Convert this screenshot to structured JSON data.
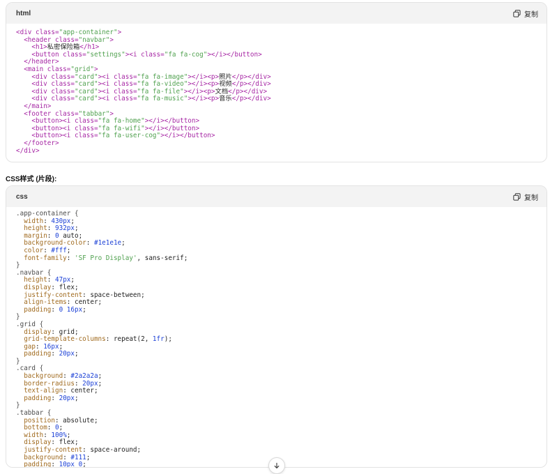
{
  "html_block": {
    "lang": "html",
    "copy_label": "复制",
    "lines": [
      [
        [
          "tag",
          "<div "
        ],
        [
          "attr",
          "class="
        ],
        [
          "str",
          "\"app-container\""
        ],
        [
          "tag",
          ">"
        ]
      ],
      [
        [
          "kw",
          "  "
        ],
        [
          "tag",
          "<header "
        ],
        [
          "attr",
          "class="
        ],
        [
          "str",
          "\"navbar\""
        ],
        [
          "tag",
          ">"
        ]
      ],
      [
        [
          "kw",
          "    "
        ],
        [
          "tag",
          "<h1>"
        ],
        [
          "kw",
          "私密保险箱"
        ],
        [
          "tag",
          "</h1>"
        ]
      ],
      [
        [
          "kw",
          "    "
        ],
        [
          "tag",
          "<button "
        ],
        [
          "attr",
          "class="
        ],
        [
          "str",
          "\"settings\""
        ],
        [
          "tag",
          "><i "
        ],
        [
          "attr",
          "class="
        ],
        [
          "str",
          "\"fa fa-cog\""
        ],
        [
          "tag",
          "></i></button>"
        ]
      ],
      [
        [
          "kw",
          "  "
        ],
        [
          "tag",
          "</header>"
        ]
      ],
      [
        [
          "kw",
          "  "
        ],
        [
          "tag",
          "<main "
        ],
        [
          "attr",
          "class="
        ],
        [
          "str",
          "\"grid\""
        ],
        [
          "tag",
          ">"
        ]
      ],
      [
        [
          "kw",
          "    "
        ],
        [
          "tag",
          "<div "
        ],
        [
          "attr",
          "class="
        ],
        [
          "str",
          "\"card\""
        ],
        [
          "tag",
          "><i "
        ],
        [
          "attr",
          "class="
        ],
        [
          "str",
          "\"fa fa-image\""
        ],
        [
          "tag",
          "></i><p>"
        ],
        [
          "kw",
          "照片"
        ],
        [
          "tag",
          "</p></div>"
        ]
      ],
      [
        [
          "kw",
          "    "
        ],
        [
          "tag",
          "<div "
        ],
        [
          "attr",
          "class="
        ],
        [
          "str",
          "\"card\""
        ],
        [
          "tag",
          "><i "
        ],
        [
          "attr",
          "class="
        ],
        [
          "str",
          "\"fa fa-video\""
        ],
        [
          "tag",
          "></i><p>"
        ],
        [
          "kw",
          "视频"
        ],
        [
          "tag",
          "</p></div>"
        ]
      ],
      [
        [
          "kw",
          "    "
        ],
        [
          "tag",
          "<div "
        ],
        [
          "attr",
          "class="
        ],
        [
          "str",
          "\"card\""
        ],
        [
          "tag",
          "><i "
        ],
        [
          "attr",
          "class="
        ],
        [
          "str",
          "\"fa fa-file\""
        ],
        [
          "tag",
          "></i><p>"
        ],
        [
          "kw",
          "文档"
        ],
        [
          "tag",
          "</p></div>"
        ]
      ],
      [
        [
          "kw",
          "    "
        ],
        [
          "tag",
          "<div "
        ],
        [
          "attr",
          "class="
        ],
        [
          "str",
          "\"card\""
        ],
        [
          "tag",
          "><i "
        ],
        [
          "attr",
          "class="
        ],
        [
          "str",
          "\"fa fa-music\""
        ],
        [
          "tag",
          "></i><p>"
        ],
        [
          "kw",
          "音乐"
        ],
        [
          "tag",
          "</p></div>"
        ]
      ],
      [
        [
          "kw",
          "  "
        ],
        [
          "tag",
          "</main>"
        ]
      ],
      [
        [
          "kw",
          "  "
        ],
        [
          "tag",
          "<footer "
        ],
        [
          "attr",
          "class="
        ],
        [
          "str",
          "\"tabbar\""
        ],
        [
          "tag",
          ">"
        ]
      ],
      [
        [
          "kw",
          "    "
        ],
        [
          "tag",
          "<button><i "
        ],
        [
          "attr",
          "class="
        ],
        [
          "str",
          "\"fa fa-home\""
        ],
        [
          "tag",
          "></i></button>"
        ]
      ],
      [
        [
          "kw",
          "    "
        ],
        [
          "tag",
          "<button><i "
        ],
        [
          "attr",
          "class="
        ],
        [
          "str",
          "\"fa fa-wifi\""
        ],
        [
          "tag",
          "></i></button>"
        ]
      ],
      [
        [
          "kw",
          "    "
        ],
        [
          "tag",
          "<button><i "
        ],
        [
          "attr",
          "class="
        ],
        [
          "str",
          "\"fa fa-user-cog\""
        ],
        [
          "tag",
          "></i></button>"
        ]
      ],
      [
        [
          "kw",
          "  "
        ],
        [
          "tag",
          "</footer>"
        ]
      ],
      [
        [
          "tag",
          "</div>"
        ]
      ]
    ]
  },
  "section_title": "CSS样式 (片段):",
  "css_block": {
    "lang": "css",
    "copy_label": "复制",
    "lines": [
      [
        [
          "sel",
          ".app-container {"
        ]
      ],
      [
        [
          "kw",
          "  "
        ],
        [
          "prop",
          "width"
        ],
        [
          "kw",
          ": "
        ],
        [
          "num",
          "430px"
        ],
        [
          "kw",
          ";"
        ]
      ],
      [
        [
          "kw",
          "  "
        ],
        [
          "prop",
          "height"
        ],
        [
          "kw",
          ": "
        ],
        [
          "num",
          "932px"
        ],
        [
          "kw",
          ";"
        ]
      ],
      [
        [
          "kw",
          "  "
        ],
        [
          "prop",
          "margin"
        ],
        [
          "kw",
          ": "
        ],
        [
          "num",
          "0"
        ],
        [
          "kw",
          " auto;"
        ]
      ],
      [
        [
          "kw",
          "  "
        ],
        [
          "prop",
          "background-color"
        ],
        [
          "kw",
          ": "
        ],
        [
          "num",
          "#1e1e1e"
        ],
        [
          "kw",
          ";"
        ]
      ],
      [
        [
          "kw",
          "  "
        ],
        [
          "prop",
          "color"
        ],
        [
          "kw",
          ": "
        ],
        [
          "num",
          "#fff"
        ],
        [
          "kw",
          ";"
        ]
      ],
      [
        [
          "kw",
          "  "
        ],
        [
          "prop",
          "font-family"
        ],
        [
          "kw",
          ": "
        ],
        [
          "str",
          "'SF Pro Display'"
        ],
        [
          "kw",
          ", sans-serif;"
        ]
      ],
      [
        [
          "sel",
          "}"
        ]
      ],
      [
        [
          "sel",
          ".navbar {"
        ]
      ],
      [
        [
          "kw",
          "  "
        ],
        [
          "prop",
          "height"
        ],
        [
          "kw",
          ": "
        ],
        [
          "num",
          "47px"
        ],
        [
          "kw",
          ";"
        ]
      ],
      [
        [
          "kw",
          "  "
        ],
        [
          "prop",
          "display"
        ],
        [
          "kw",
          ": flex;"
        ]
      ],
      [
        [
          "kw",
          "  "
        ],
        [
          "prop",
          "justify-content"
        ],
        [
          "kw",
          ": space-between;"
        ]
      ],
      [
        [
          "kw",
          "  "
        ],
        [
          "prop",
          "align-items"
        ],
        [
          "kw",
          ": center;"
        ]
      ],
      [
        [
          "kw",
          "  "
        ],
        [
          "prop",
          "padding"
        ],
        [
          "kw",
          ": "
        ],
        [
          "num",
          "0 16px"
        ],
        [
          "kw",
          ";"
        ]
      ],
      [
        [
          "sel",
          "}"
        ]
      ],
      [
        [
          "sel",
          ".grid {"
        ]
      ],
      [
        [
          "kw",
          "  "
        ],
        [
          "prop",
          "display"
        ],
        [
          "kw",
          ": grid;"
        ]
      ],
      [
        [
          "kw",
          "  "
        ],
        [
          "prop",
          "grid-template-columns"
        ],
        [
          "kw",
          ": repeat(2, "
        ],
        [
          "num",
          "1fr"
        ],
        [
          "kw",
          ");"
        ]
      ],
      [
        [
          "kw",
          "  "
        ],
        [
          "prop",
          "gap"
        ],
        [
          "kw",
          ": "
        ],
        [
          "num",
          "16px"
        ],
        [
          "kw",
          ";"
        ]
      ],
      [
        [
          "kw",
          "  "
        ],
        [
          "prop",
          "padding"
        ],
        [
          "kw",
          ": "
        ],
        [
          "num",
          "20px"
        ],
        [
          "kw",
          ";"
        ]
      ],
      [
        [
          "sel",
          "}"
        ]
      ],
      [
        [
          "sel",
          ".card {"
        ]
      ],
      [
        [
          "kw",
          "  "
        ],
        [
          "prop",
          "background"
        ],
        [
          "kw",
          ": "
        ],
        [
          "num",
          "#2a2a2a"
        ],
        [
          "kw",
          ";"
        ]
      ],
      [
        [
          "kw",
          "  "
        ],
        [
          "prop",
          "border-radius"
        ],
        [
          "kw",
          ": "
        ],
        [
          "num",
          "20px"
        ],
        [
          "kw",
          ";"
        ]
      ],
      [
        [
          "kw",
          "  "
        ],
        [
          "prop",
          "text-align"
        ],
        [
          "kw",
          ": center;"
        ]
      ],
      [
        [
          "kw",
          "  "
        ],
        [
          "prop",
          "padding"
        ],
        [
          "kw",
          ": "
        ],
        [
          "num",
          "20px"
        ],
        [
          "kw",
          ";"
        ]
      ],
      [
        [
          "sel",
          "}"
        ]
      ],
      [
        [
          "sel",
          ".tabbar {"
        ]
      ],
      [
        [
          "kw",
          "  "
        ],
        [
          "prop",
          "position"
        ],
        [
          "kw",
          ": absolute;"
        ]
      ],
      [
        [
          "kw",
          "  "
        ],
        [
          "prop",
          "bottom"
        ],
        [
          "kw",
          ": "
        ],
        [
          "num",
          "0"
        ],
        [
          "kw",
          ";"
        ]
      ],
      [
        [
          "kw",
          "  "
        ],
        [
          "prop",
          "width"
        ],
        [
          "kw",
          ": "
        ],
        [
          "num",
          "100%"
        ],
        [
          "kw",
          ";"
        ]
      ],
      [
        [
          "kw",
          "  "
        ],
        [
          "prop",
          "display"
        ],
        [
          "kw",
          ": flex;"
        ]
      ],
      [
        [
          "kw",
          "  "
        ],
        [
          "prop",
          "justify-content"
        ],
        [
          "kw",
          ": space-around;"
        ]
      ],
      [
        [
          "kw",
          "  "
        ],
        [
          "prop",
          "background"
        ],
        [
          "kw",
          ": "
        ],
        [
          "num",
          "#111"
        ],
        [
          "kw",
          ";"
        ]
      ],
      [
        [
          "kw",
          "  "
        ],
        [
          "prop",
          "padding"
        ],
        [
          "kw",
          ": "
        ],
        [
          "num",
          "10px 0"
        ],
        [
          "kw",
          ";"
        ]
      ],
      [
        [
          "sel",
          "}"
        ]
      ]
    ]
  },
  "icons": {
    "copy": "copy-icon",
    "scroll": "arrow-down-icon"
  }
}
